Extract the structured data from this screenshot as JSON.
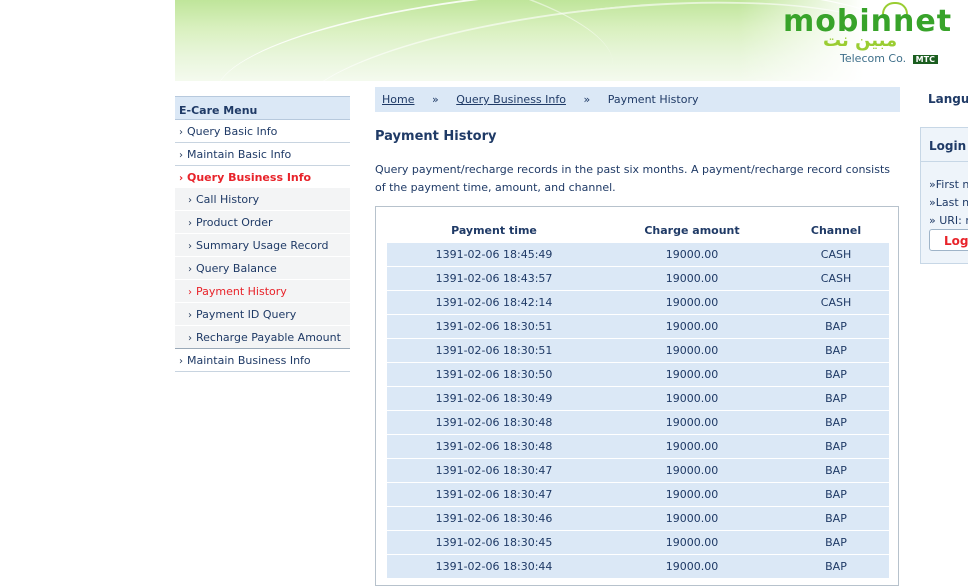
{
  "header": {
    "brand": "mobinnet",
    "brand_arabic": "مبين نت",
    "tagline": "Telecom Co.",
    "tagline_badge": "MTC"
  },
  "sidebar": {
    "title": "E-Care Menu",
    "items": [
      {
        "label": "Query Basic Info"
      },
      {
        "label": "Maintain Basic Info"
      },
      {
        "label": "Query Business Info",
        "active": true
      }
    ],
    "subitems": [
      {
        "label": "Call History"
      },
      {
        "label": "Product Order"
      },
      {
        "label": "Summary Usage Record"
      },
      {
        "label": "Query Balance"
      },
      {
        "label": "Payment History",
        "current": true
      },
      {
        "label": "Payment ID Query"
      },
      {
        "label": "Recharge Payable Amount"
      }
    ],
    "after_items": [
      {
        "label": "Maintain Business Info"
      }
    ]
  },
  "breadcrumb": {
    "home": "Home",
    "sep": "»",
    "section": "Query Business Info",
    "current": "Payment History"
  },
  "page": {
    "title": "Payment History",
    "description": "Query payment/recharge records in the past six months. A payment/recharge record consists of the payment time, amount, and channel."
  },
  "table": {
    "headers": [
      "Payment time",
      "Charge amount",
      "Channel"
    ],
    "rows": [
      [
        "1391-02-06 18:45:49",
        "19000.00",
        "CASH"
      ],
      [
        "1391-02-06 18:43:57",
        "19000.00",
        "CASH"
      ],
      [
        "1391-02-06 18:42:14",
        "19000.00",
        "CASH"
      ],
      [
        "1391-02-06 18:30:51",
        "19000.00",
        "BAP"
      ],
      [
        "1391-02-06 18:30:51",
        "19000.00",
        "BAP"
      ],
      [
        "1391-02-06 18:30:50",
        "19000.00",
        "BAP"
      ],
      [
        "1391-02-06 18:30:49",
        "19000.00",
        "BAP"
      ],
      [
        "1391-02-06 18:30:48",
        "19000.00",
        "BAP"
      ],
      [
        "1391-02-06 18:30:48",
        "19000.00",
        "BAP"
      ],
      [
        "1391-02-06 18:30:47",
        "19000.00",
        "BAP"
      ],
      [
        "1391-02-06 18:30:47",
        "19000.00",
        "BAP"
      ],
      [
        "1391-02-06 18:30:46",
        "19000.00",
        "BAP"
      ],
      [
        "1391-02-06 18:30:45",
        "19000.00",
        "BAP"
      ],
      [
        "1391-02-06 18:30:44",
        "19000.00",
        "BAP"
      ]
    ]
  },
  "right": {
    "language_label": "Langu",
    "login_title": "Login I",
    "first_name": "»First na",
    "last_name": "»Last na",
    "uri": "» URI: m",
    "logout_label": "Logo"
  },
  "colors": {
    "accent_red": "#e8232a",
    "nav_blue": "#1f3a66",
    "row_blue": "#dbe8f6",
    "brand_green": "#38a32a"
  }
}
